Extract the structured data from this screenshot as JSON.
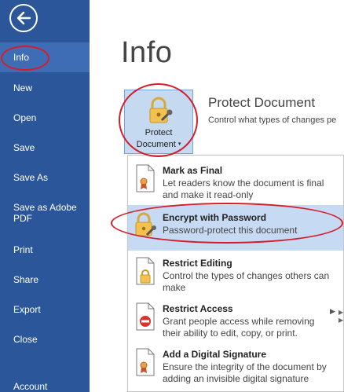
{
  "sidebar": {
    "items": [
      {
        "label": "Info"
      },
      {
        "label": "New"
      },
      {
        "label": "Open"
      },
      {
        "label": "Save"
      },
      {
        "label": "Save As"
      },
      {
        "label": "Save as Adobe PDF"
      },
      {
        "label": "Print"
      },
      {
        "label": "Share"
      },
      {
        "label": "Export"
      },
      {
        "label": "Close"
      },
      {
        "label": "Account"
      }
    ]
  },
  "main": {
    "title": "Info",
    "protect_button": {
      "line1": "Protect",
      "line2": "Document"
    },
    "protect_heading": "Protect Document",
    "protect_description": "Control what types of changes pe"
  },
  "menu": {
    "items": [
      {
        "title": "Mark as Final",
        "description": "Let readers know the document is final and make it read-only",
        "icon": "ribbon-document-icon"
      },
      {
        "title": "Encrypt with Password",
        "description": "Password-protect this document",
        "icon": "lock-key-icon"
      },
      {
        "title": "Restrict Editing",
        "description": "Control the types of changes others can make",
        "icon": "lock-document-icon"
      },
      {
        "title": "Restrict Access",
        "description": "Grant people access while removing their ability to edit, copy, or print.",
        "icon": "no-entry-document-icon"
      },
      {
        "title": "Add a Digital Signature",
        "description": "Ensure the integrity of the document by adding an invisible digital signature",
        "icon": "ribbon-document-icon"
      }
    ]
  },
  "colors": {
    "sidebar": "#2b579a",
    "sidebar_active": "#3f6db5",
    "highlight": "#c7daf3",
    "annotation": "#d51c2a"
  }
}
